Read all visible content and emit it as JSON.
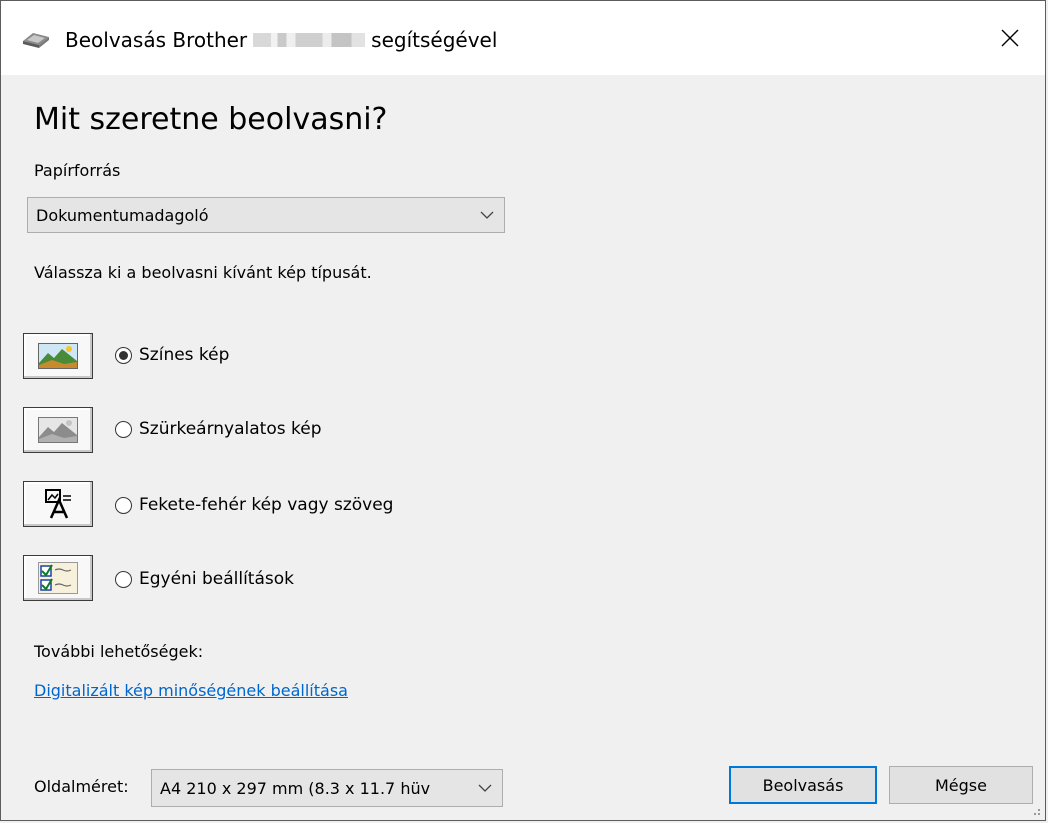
{
  "window": {
    "title_prefix": "Beolvasás Brother",
    "title_suffix": "segítségével",
    "close_glyph": "✕"
  },
  "page_title": "Mit szeretne beolvasni?",
  "paper_source": {
    "label": "Papírforrás",
    "value": "Dokumentumadagoló"
  },
  "image_type_prompt": "Válassza ki a beolvasni kívánt kép típusát.",
  "image_types": [
    {
      "label": "Színes kép",
      "icon": "color-picture-icon",
      "selected": true
    },
    {
      "label": "Szürkeárnyalatos kép",
      "icon": "grayscale-picture-icon",
      "selected": false
    },
    {
      "label": "Fekete-fehér kép vagy szöveg",
      "icon": "black-white-text-icon",
      "selected": false
    },
    {
      "label": "Egyéni beállítások",
      "icon": "custom-settings-icon",
      "selected": false
    }
  ],
  "more_options": {
    "label": "További lehetőségek:",
    "link": "Digitalizált kép minőségének beállítása"
  },
  "page_size": {
    "label": "Oldalméret:",
    "value": "A4 210 x 297 mm (8.3 x 11.7 hüv"
  },
  "buttons": {
    "scan": "Beolvasás",
    "cancel": "Mégse"
  },
  "colors": {
    "accent": "#0078d7",
    "link": "#0066cc",
    "background": "#f0f0f0"
  }
}
